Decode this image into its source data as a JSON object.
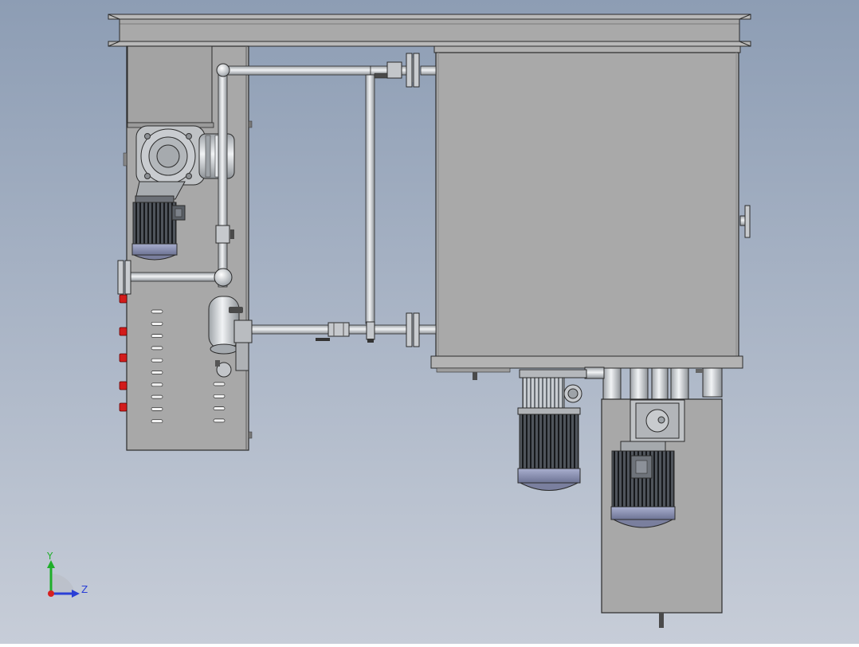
{
  "viewport": {
    "background_top": "#8d9db4",
    "background_bottom": "#c7cdd8"
  },
  "triad": {
    "y_label": "Y",
    "z_label": "Z",
    "y_color": "#1fae2a",
    "z_color": "#2a3fd6",
    "x_color": "#d62020"
  },
  "colors": {
    "panel": "#a6a6a6",
    "panel_dark": "#8f8f8f",
    "pipe": "#d9dce0",
    "motor": "#5a5f66",
    "motor_cap": "#8e95b8",
    "red_plug": "#d21b1b",
    "outline": "#2b2b2b"
  },
  "parts": [
    "frame-beam",
    "control-cabinet",
    "gear-pump",
    "left-pump-motor",
    "main-tank",
    "connecting-pipes",
    "flanges",
    "ball-valves",
    "filter-housing",
    "lower-pump-motor",
    "lower-cabinet",
    "lower-cabinet-motor"
  ]
}
